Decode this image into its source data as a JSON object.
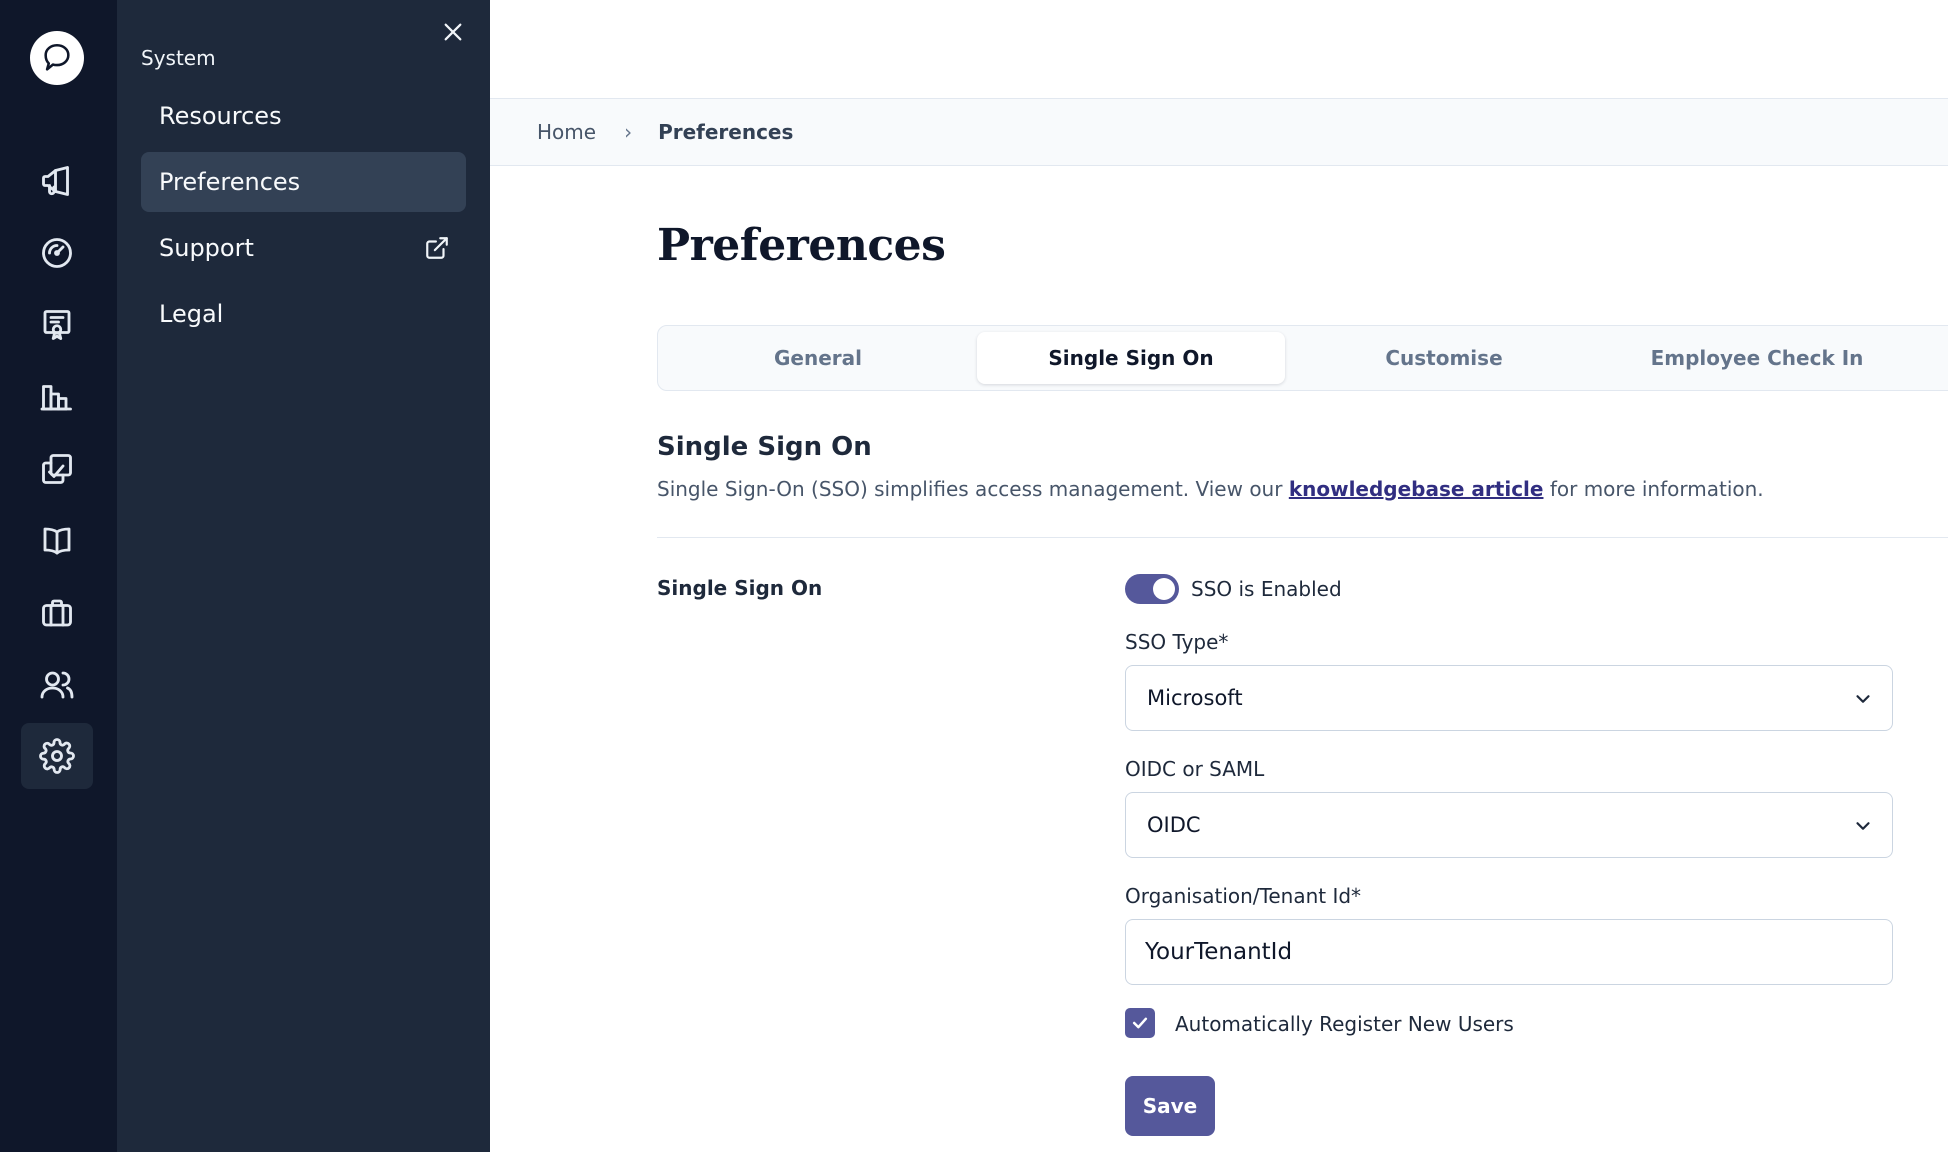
{
  "rail": {
    "icons": [
      "logo-icon",
      "megaphone-icon",
      "gauge-icon",
      "certificate-icon",
      "bar-chart-icon",
      "checklist-icon",
      "book-icon",
      "briefcase-icon",
      "users-icon",
      "gear-icon"
    ],
    "active": "gear-icon"
  },
  "submenu": {
    "section_title": "System",
    "items": [
      {
        "label": "Resources"
      },
      {
        "label": "Preferences"
      },
      {
        "label": "Support"
      },
      {
        "label": "Legal"
      }
    ],
    "active": "Preferences"
  },
  "breadcrumb": {
    "home": "Home",
    "separator": "›",
    "current": "Preferences"
  },
  "page": {
    "title": "Preferences"
  },
  "tabs": [
    {
      "label": "General"
    },
    {
      "label": "Single Sign On"
    },
    {
      "label": "Customise"
    },
    {
      "label": "Employee Check In"
    }
  ],
  "active_tab": "Single Sign On",
  "section": {
    "heading": "Single Sign On",
    "desc_before": "Single Sign-On (SSO) simplifies access management. View our ",
    "desc_link": "knowledgebase article",
    "desc_after": " for more information."
  },
  "form": {
    "row_label": "Single Sign On",
    "sso_toggle_label": "SSO is Enabled",
    "sso_enabled": true,
    "sso_type_label": "SSO Type*",
    "sso_type_value": "Microsoft",
    "protocol_label": "OIDC or SAML",
    "protocol_value": "OIDC",
    "tenant_label": "Organisation/Tenant Id*",
    "tenant_value": "YourTenantId",
    "auto_register_label": "Automatically Register New Users",
    "auto_register_checked": true,
    "save_label": "Save"
  },
  "colors": {
    "rail_bg": "#0f172a",
    "submenu_bg": "#1e293b",
    "accent": "#55589b",
    "link": "#312e81"
  }
}
